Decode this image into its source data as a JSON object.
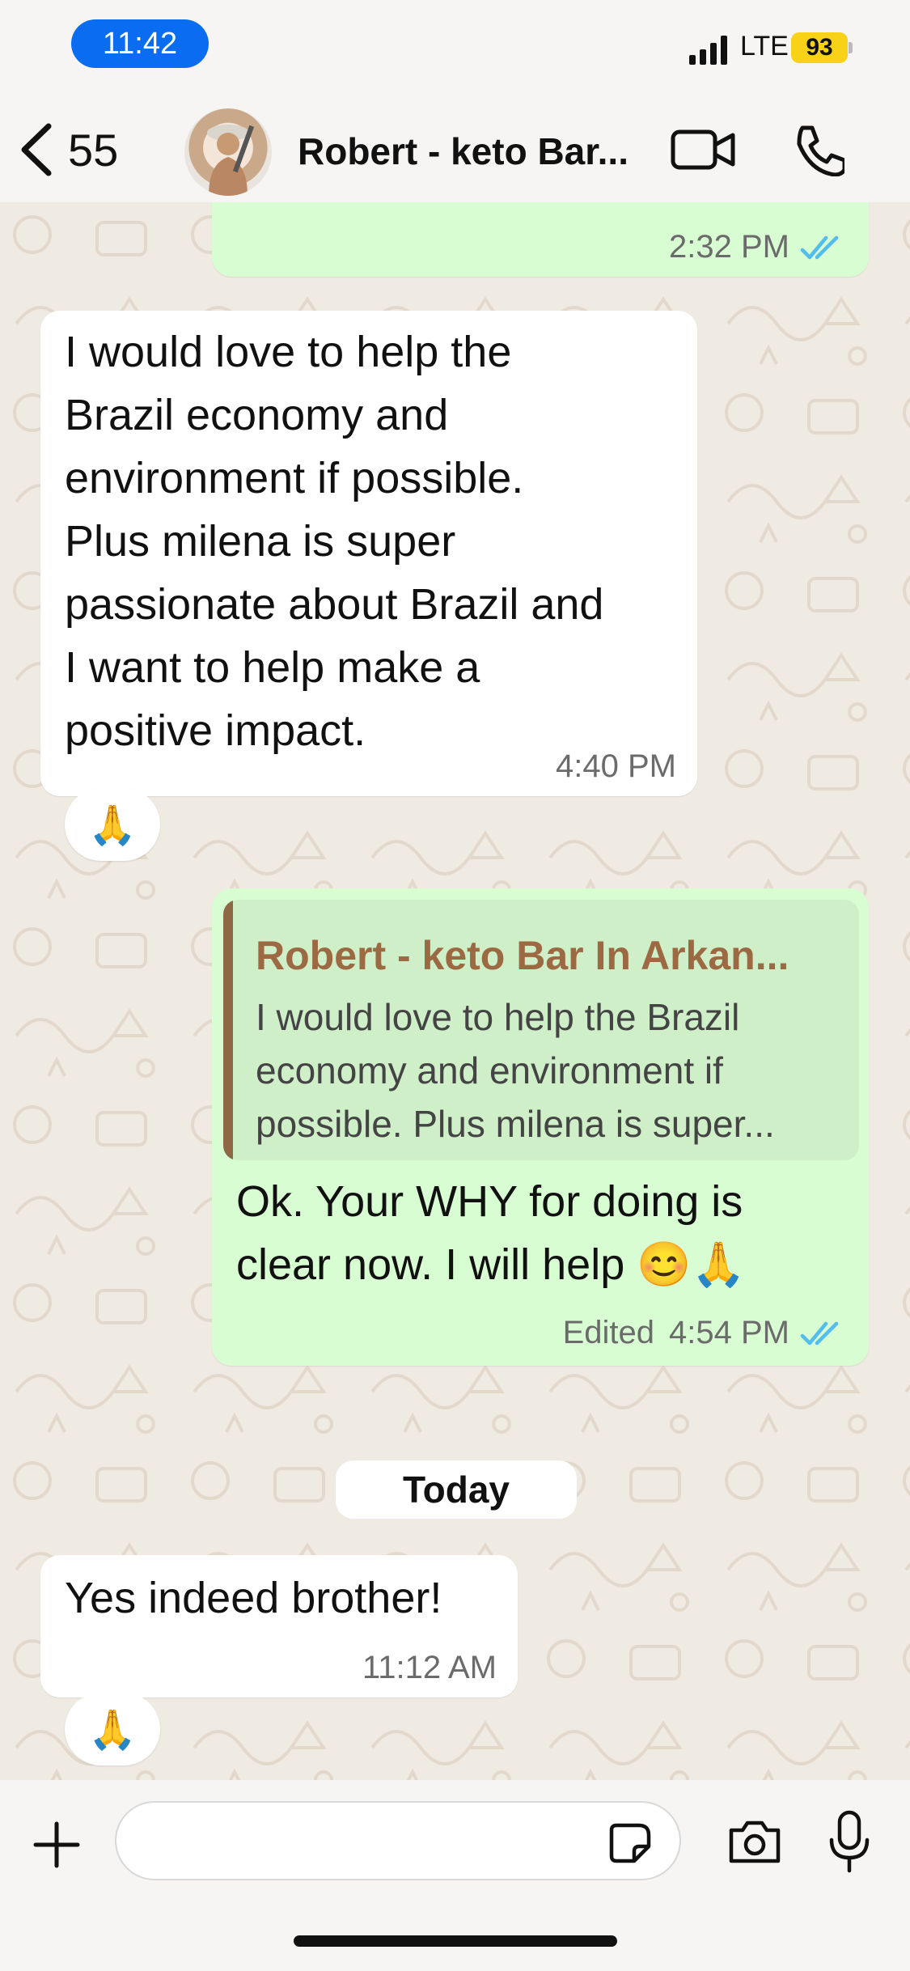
{
  "status_bar": {
    "time": "11:42",
    "network": "LTE",
    "battery": "93"
  },
  "header": {
    "back_count": "55",
    "contact_name": "Robert - keto Bar..."
  },
  "messages": [
    {
      "direction": "out",
      "time": "2:32 PM"
    },
    {
      "direction": "in",
      "lines": [
        "I would love to help the",
        "Brazil economy and",
        "environment if possible.",
        "Plus milena is super",
        "passionate about Brazil and",
        "I want to help make a",
        "positive impact."
      ],
      "time": "4:40 PM",
      "reaction": "🙏"
    },
    {
      "direction": "out",
      "quote": {
        "author": "Robert - keto Bar In Arkan...",
        "lines": [
          "I would love to help the Brazil",
          "economy and environment if",
          "possible. Plus milena is super..."
        ]
      },
      "lines": [
        "Ok. Your WHY for doing is",
        "clear now. I will help 😊🙏"
      ],
      "edited": "Edited",
      "time": "4:54 PM"
    },
    {
      "direction": "in",
      "lines": [
        "Yes indeed brother!"
      ],
      "time": "11:12 AM",
      "reaction": "🙏"
    }
  ],
  "date_separator": "Today",
  "composer": {
    "placeholder": ""
  },
  "icons": {
    "back": "chevron-left-icon",
    "video": "video-camera-icon",
    "call": "phone-icon",
    "read": "double-check-icon",
    "plus": "plus-icon",
    "sticker": "sticker-icon",
    "camera": "camera-icon",
    "mic": "microphone-icon"
  },
  "colors": {
    "outgoing_bubble": "#d9fdd3",
    "incoming_bubble": "#ffffff",
    "read_ticks": "#53bdeb",
    "quote_author": "#9b6a43",
    "time_pill": "#0a6cf0",
    "battery": "#f7d217"
  }
}
